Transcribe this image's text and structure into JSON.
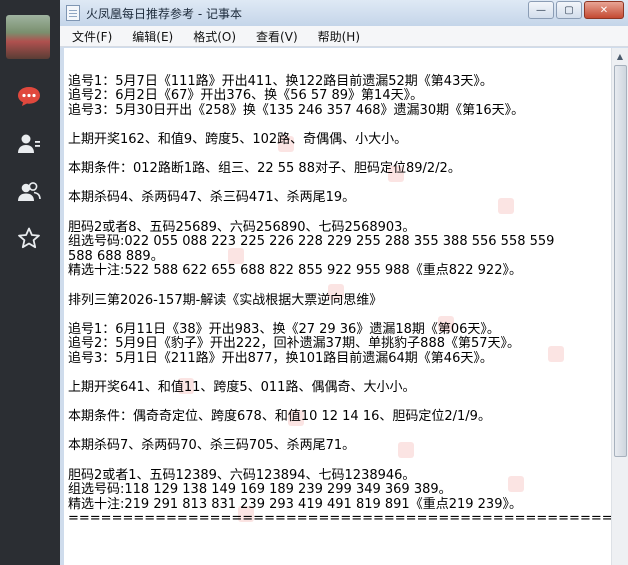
{
  "sidebar": {
    "icons": [
      "chat-icon",
      "contacts-icon",
      "group-icon",
      "favorites-icon"
    ]
  },
  "window": {
    "title": "火凤凰每日推荐参考 - 记事本",
    "controls": {
      "minimize": "—",
      "maximize": "▢",
      "close": "✕"
    }
  },
  "menu": [
    "文件(F)",
    "编辑(E)",
    "格式(O)",
    "查看(V)",
    "帮助(H)"
  ],
  "content": {
    "lines": [
      "",
      "追号1：5月7日《111路》开出411、换122路目前遗漏52期《第43天》。",
      "追号2：6月2日《67》开出376、换《56 57 89》第14天》。",
      "追号3：5月30日开出《258》换《135 246 357 468》遗漏30期《第16天》。",
      "",
      "上期开奖162、和值9、跨度5、102路、奇偶偶、小大小。",
      "",
      "本期条件：012路断1路、组三、22 55 88对子、胆码定位89/2/2。",
      "",
      "本期杀码4、杀两码47、杀三码471、杀两尾19。",
      "",
      "胆码2或者8、五码25689、六码256890、七码2568903。",
      "组选号码:022 055 088 223 225 226 228 229 255 288 355 388 556 558 559",
      "588 688 889。",
      "精选十注:522 588 622 655 688 822 855 922 955 988《重点822 922》。",
      "",
      "排列三第2026-157期-解读《实战根据大票逆向思维》",
      "",
      "追号1：6月11日《38》开出983、换《27 29 36》遗漏18期《第06天》。",
      "追号2：5月9日《豹子》开出222，回补遗漏37期、单挑豹子888《第57天》。",
      "追号3：5月1日《211路》开出877，换101路目前遗漏64期《第46天》。",
      "",
      "上期开奖641、和值11、跨度5、011路、偶偶奇、大小小。",
      "",
      "本期条件：偶奇奇定位、跨度678、和值10 12 14 16、胆码定位2/1/9。",
      "",
      "本期杀码7、杀两码70、杀三码705、杀两尾71。",
      "",
      "胆码2或者1、五码12389、六码123894、七码1238946。",
      "组选号码:118 129 138 149 169 189 239 299 349 369 389。",
      "精选十注:219 291 813 831 239 293 419 491 819 891《重点219 239》。",
      "================================================================"
    ]
  }
}
